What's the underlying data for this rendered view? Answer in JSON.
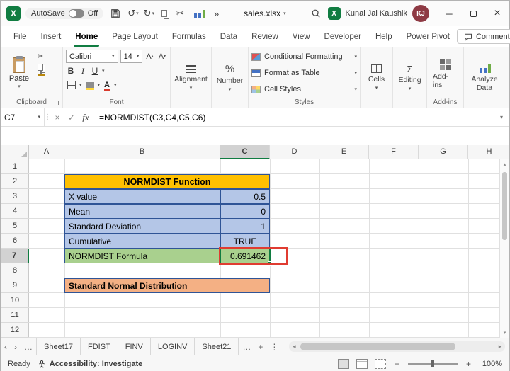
{
  "window": {
    "autosave_label": "AutoSave",
    "autosave_state": "Off",
    "title": "sales.xlsx",
    "user_name": "Kunal Jai Kaushik",
    "user_initials": "KJ"
  },
  "colors": {
    "excel_green": "#107c41",
    "title_yellow": "#ffc000",
    "input_blue": "#b4c6e7",
    "formula_green": "#a9d08e",
    "footer_orange": "#f4b084",
    "table_border": "#2f5496",
    "annotation_red": "#e03c31",
    "avatar_maroon": "#8e3a44"
  },
  "ribbon_tabs": [
    {
      "label": "File",
      "active": false
    },
    {
      "label": "Insert",
      "active": false
    },
    {
      "label": "Home",
      "active": true
    },
    {
      "label": "Page Layout",
      "active": false
    },
    {
      "label": "Formulas",
      "active": false
    },
    {
      "label": "Data",
      "active": false
    },
    {
      "label": "Review",
      "active": false
    },
    {
      "label": "View",
      "active": false
    },
    {
      "label": "Developer",
      "active": false
    },
    {
      "label": "Help",
      "active": false
    },
    {
      "label": "Power Pivot",
      "active": false
    }
  ],
  "comments_label": "Comments",
  "ribbon": {
    "paste_label": "Paste",
    "clipboard_group_label": "Clipboard",
    "font_name": "Calibri",
    "font_size": "14",
    "bold_label": "B",
    "italic_label": "I",
    "underline_label": "U",
    "font_group_label": "Font",
    "alignment_label": "Alignment",
    "number_label": "Number",
    "conditional_formatting_label": "Conditional Formatting",
    "format_as_table_label": "Format as Table",
    "cell_styles_label": "Cell Styles",
    "styles_group_label": "Styles",
    "cells_label": "Cells",
    "editing_label": "Editing",
    "addins_label": "Add-ins",
    "addins_group_label": "Add-ins",
    "analyze_data_label": "Analyze Data"
  },
  "formula_bar": {
    "name_box": "C7",
    "fx_label": "fx",
    "formula": "=NORMDIST(C3,C4,C5,C6)"
  },
  "grid": {
    "columns": [
      "A",
      "B",
      "C",
      "D",
      "E",
      "F",
      "G",
      "H"
    ],
    "rows": [
      "1",
      "2",
      "3",
      "4",
      "5",
      "6",
      "7",
      "8",
      "9",
      "10",
      "11",
      "12"
    ],
    "selected_column": "C",
    "selected_row": "7",
    "selected_cell": "C7",
    "cells": [
      {
        "ref": "B2",
        "text": "NORMDIST Function",
        "style": "title",
        "span": 2,
        "align": "center"
      },
      {
        "ref": "B3",
        "text": "X value",
        "style": "blue",
        "align": "left"
      },
      {
        "ref": "C3",
        "text": "0.5",
        "style": "blue",
        "align": "right"
      },
      {
        "ref": "B4",
        "text": "Mean",
        "style": "blue",
        "align": "left"
      },
      {
        "ref": "C4",
        "text": "0",
        "style": "blue",
        "align": "right"
      },
      {
        "ref": "B5",
        "text": "Standard Deviation",
        "style": "blue",
        "align": "left"
      },
      {
        "ref": "C5",
        "text": "1",
        "style": "blue",
        "align": "right"
      },
      {
        "ref": "B6",
        "text": "Cumulative",
        "style": "blue",
        "align": "left"
      },
      {
        "ref": "C6",
        "text": "TRUE",
        "style": "blue",
        "align": "center"
      },
      {
        "ref": "B7",
        "text": "NORMDIST Formula",
        "style": "green",
        "align": "left"
      },
      {
        "ref": "C7",
        "text": "0.691462",
        "style": "green",
        "align": "right",
        "selected": true,
        "annotated": true
      },
      {
        "ref": "B9",
        "text": "Standard Normal Distribution",
        "style": "orange",
        "span": 2,
        "align": "left"
      }
    ]
  },
  "sheet_tabs": [
    "Sheet17",
    "FDIST",
    "FINV",
    "LOGINV",
    "Sheet21"
  ],
  "status_bar": {
    "mode": "Ready",
    "accessibility": "Accessibility: Investigate",
    "zoom": "100%"
  }
}
